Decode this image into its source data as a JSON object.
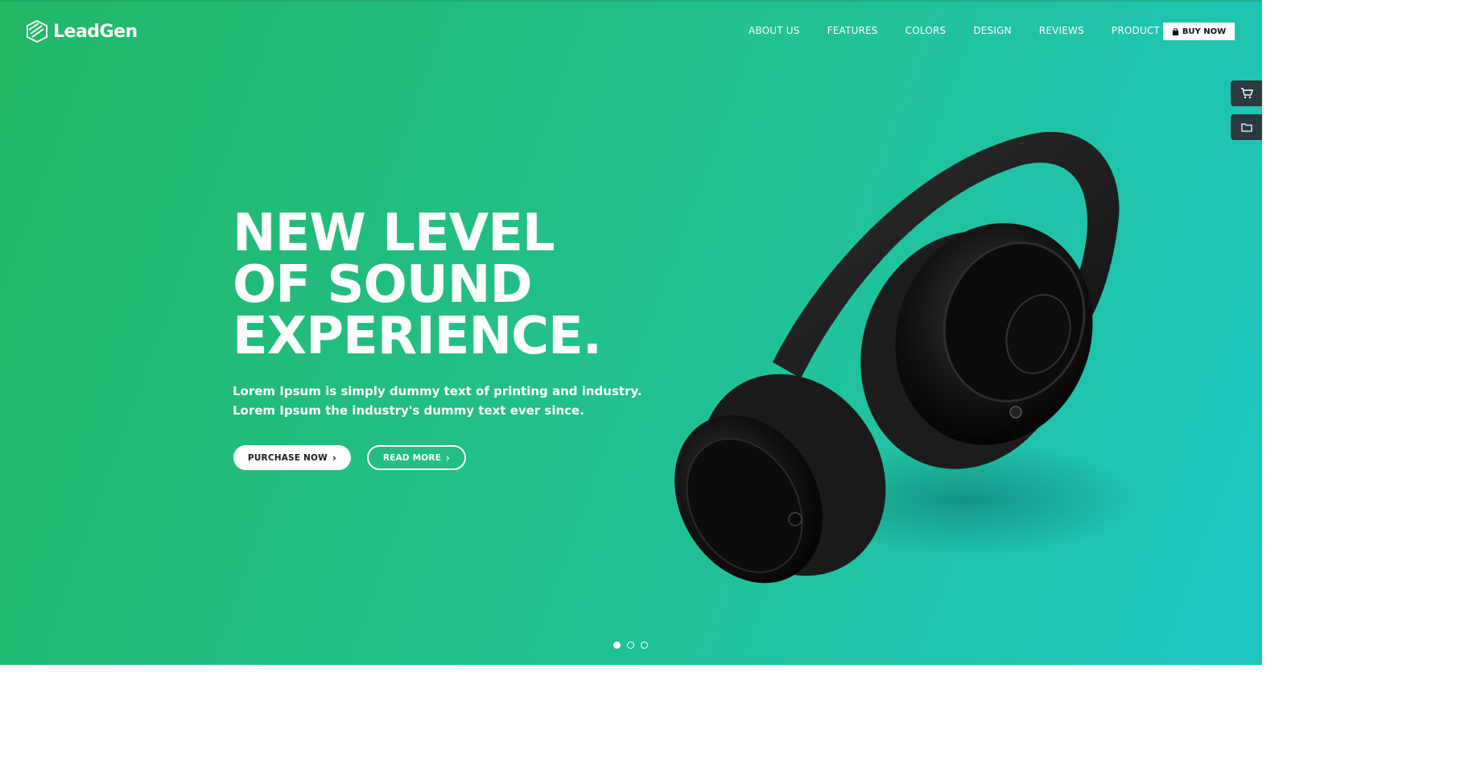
{
  "brand": {
    "name": "LeadGen"
  },
  "nav": {
    "items": [
      {
        "label": "ABOUT US"
      },
      {
        "label": "FEATURES"
      },
      {
        "label": "COLORS"
      },
      {
        "label": "DESIGN"
      },
      {
        "label": "REVIEWS"
      },
      {
        "label": "PRODUCT"
      }
    ],
    "buy_label": "BUY NOW"
  },
  "side_tabs": [
    {
      "icon": "cart-icon"
    },
    {
      "icon": "folder-icon"
    }
  ],
  "hero": {
    "headline": [
      "NEW LEVEL",
      "OF SOUND",
      "EXPERIENCE."
    ],
    "subtext": [
      "Lorem Ipsum is simply dummy text of printing and industry.",
      "Lorem Ipsum the industry's dummy text ever since."
    ],
    "primary_button": "PURCHASE NOW",
    "secondary_button": "READ MORE",
    "chevron": "›"
  },
  "slider": {
    "count": 3,
    "active": 1
  },
  "colors": {
    "gradient_start": "#22b866",
    "gradient_end": "#1ec6c2",
    "side_tab": "#2a3a3f"
  }
}
